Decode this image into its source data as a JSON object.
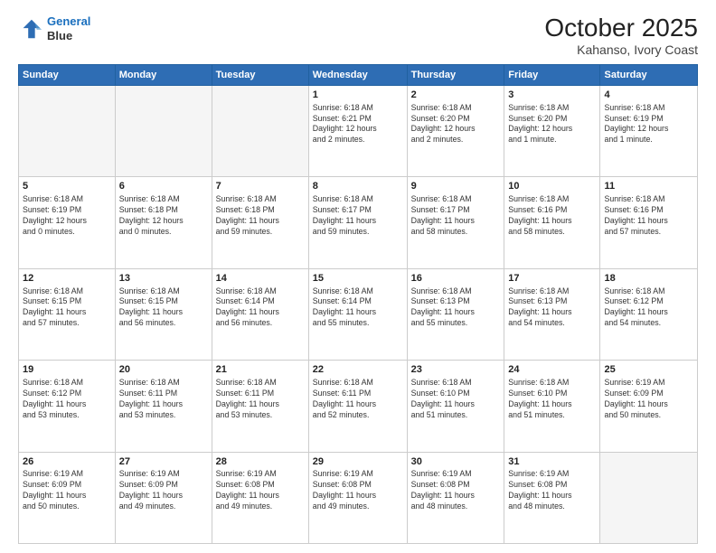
{
  "header": {
    "logo_line1": "General",
    "logo_line2": "Blue",
    "title": "October 2025",
    "subtitle": "Kahanso, Ivory Coast"
  },
  "weekdays": [
    "Sunday",
    "Monday",
    "Tuesday",
    "Wednesday",
    "Thursday",
    "Friday",
    "Saturday"
  ],
  "weeks": [
    [
      {
        "day": "",
        "info": ""
      },
      {
        "day": "",
        "info": ""
      },
      {
        "day": "",
        "info": ""
      },
      {
        "day": "1",
        "info": "Sunrise: 6:18 AM\nSunset: 6:21 PM\nDaylight: 12 hours\nand 2 minutes."
      },
      {
        "day": "2",
        "info": "Sunrise: 6:18 AM\nSunset: 6:20 PM\nDaylight: 12 hours\nand 2 minutes."
      },
      {
        "day": "3",
        "info": "Sunrise: 6:18 AM\nSunset: 6:20 PM\nDaylight: 12 hours\nand 1 minute."
      },
      {
        "day": "4",
        "info": "Sunrise: 6:18 AM\nSunset: 6:19 PM\nDaylight: 12 hours\nand 1 minute."
      }
    ],
    [
      {
        "day": "5",
        "info": "Sunrise: 6:18 AM\nSunset: 6:19 PM\nDaylight: 12 hours\nand 0 minutes."
      },
      {
        "day": "6",
        "info": "Sunrise: 6:18 AM\nSunset: 6:18 PM\nDaylight: 12 hours\nand 0 minutes."
      },
      {
        "day": "7",
        "info": "Sunrise: 6:18 AM\nSunset: 6:18 PM\nDaylight: 11 hours\nand 59 minutes."
      },
      {
        "day": "8",
        "info": "Sunrise: 6:18 AM\nSunset: 6:17 PM\nDaylight: 11 hours\nand 59 minutes."
      },
      {
        "day": "9",
        "info": "Sunrise: 6:18 AM\nSunset: 6:17 PM\nDaylight: 11 hours\nand 58 minutes."
      },
      {
        "day": "10",
        "info": "Sunrise: 6:18 AM\nSunset: 6:16 PM\nDaylight: 11 hours\nand 58 minutes."
      },
      {
        "day": "11",
        "info": "Sunrise: 6:18 AM\nSunset: 6:16 PM\nDaylight: 11 hours\nand 57 minutes."
      }
    ],
    [
      {
        "day": "12",
        "info": "Sunrise: 6:18 AM\nSunset: 6:15 PM\nDaylight: 11 hours\nand 57 minutes."
      },
      {
        "day": "13",
        "info": "Sunrise: 6:18 AM\nSunset: 6:15 PM\nDaylight: 11 hours\nand 56 minutes."
      },
      {
        "day": "14",
        "info": "Sunrise: 6:18 AM\nSunset: 6:14 PM\nDaylight: 11 hours\nand 56 minutes."
      },
      {
        "day": "15",
        "info": "Sunrise: 6:18 AM\nSunset: 6:14 PM\nDaylight: 11 hours\nand 55 minutes."
      },
      {
        "day": "16",
        "info": "Sunrise: 6:18 AM\nSunset: 6:13 PM\nDaylight: 11 hours\nand 55 minutes."
      },
      {
        "day": "17",
        "info": "Sunrise: 6:18 AM\nSunset: 6:13 PM\nDaylight: 11 hours\nand 54 minutes."
      },
      {
        "day": "18",
        "info": "Sunrise: 6:18 AM\nSunset: 6:12 PM\nDaylight: 11 hours\nand 54 minutes."
      }
    ],
    [
      {
        "day": "19",
        "info": "Sunrise: 6:18 AM\nSunset: 6:12 PM\nDaylight: 11 hours\nand 53 minutes."
      },
      {
        "day": "20",
        "info": "Sunrise: 6:18 AM\nSunset: 6:11 PM\nDaylight: 11 hours\nand 53 minutes."
      },
      {
        "day": "21",
        "info": "Sunrise: 6:18 AM\nSunset: 6:11 PM\nDaylight: 11 hours\nand 53 minutes."
      },
      {
        "day": "22",
        "info": "Sunrise: 6:18 AM\nSunset: 6:11 PM\nDaylight: 11 hours\nand 52 minutes."
      },
      {
        "day": "23",
        "info": "Sunrise: 6:18 AM\nSunset: 6:10 PM\nDaylight: 11 hours\nand 51 minutes."
      },
      {
        "day": "24",
        "info": "Sunrise: 6:18 AM\nSunset: 6:10 PM\nDaylight: 11 hours\nand 51 minutes."
      },
      {
        "day": "25",
        "info": "Sunrise: 6:19 AM\nSunset: 6:09 PM\nDaylight: 11 hours\nand 50 minutes."
      }
    ],
    [
      {
        "day": "26",
        "info": "Sunrise: 6:19 AM\nSunset: 6:09 PM\nDaylight: 11 hours\nand 50 minutes."
      },
      {
        "day": "27",
        "info": "Sunrise: 6:19 AM\nSunset: 6:09 PM\nDaylight: 11 hours\nand 49 minutes."
      },
      {
        "day": "28",
        "info": "Sunrise: 6:19 AM\nSunset: 6:08 PM\nDaylight: 11 hours\nand 49 minutes."
      },
      {
        "day": "29",
        "info": "Sunrise: 6:19 AM\nSunset: 6:08 PM\nDaylight: 11 hours\nand 49 minutes."
      },
      {
        "day": "30",
        "info": "Sunrise: 6:19 AM\nSunset: 6:08 PM\nDaylight: 11 hours\nand 48 minutes."
      },
      {
        "day": "31",
        "info": "Sunrise: 6:19 AM\nSunset: 6:08 PM\nDaylight: 11 hours\nand 48 minutes."
      },
      {
        "day": "",
        "info": ""
      }
    ]
  ]
}
